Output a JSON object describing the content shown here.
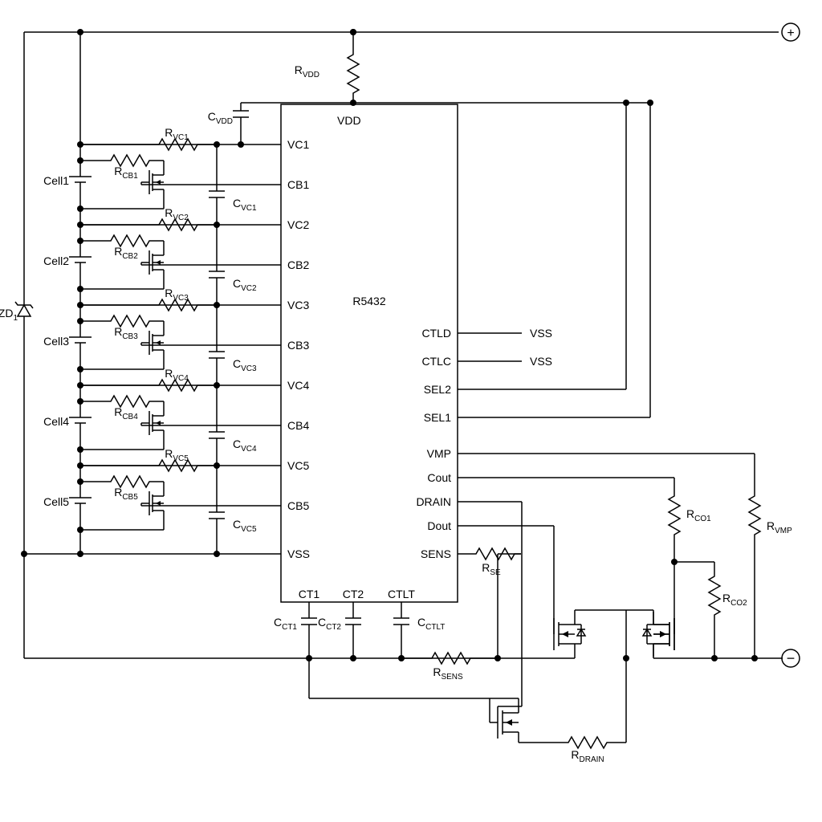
{
  "ic": {
    "name": "R5432"
  },
  "pins_left": [
    "VDD",
    "VC1",
    "CB1",
    "VC2",
    "CB2",
    "VC3",
    "CB3",
    "VC4",
    "CB4",
    "VC5",
    "CB5",
    "VSS"
  ],
  "pins_right": [
    "CTLD",
    "CTLC",
    "SEL2",
    "SEL1",
    "VMP",
    "Cout",
    "DRAIN",
    "Dout",
    "SENS"
  ],
  "pins_bottom": [
    "CT1",
    "CT2",
    "CTLT"
  ],
  "cells": [
    "Cell1",
    "Cell2",
    "Cell3",
    "Cell4",
    "Cell5"
  ],
  "resistors": {
    "rvdd": "R",
    "rvdd_sub": "VDD",
    "rvc": [
      "R",
      "VC1",
      "R",
      "VC2",
      "R",
      "VC3",
      "R",
      "VC4",
      "R",
      "VC5"
    ],
    "rcb": [
      "R",
      "CB1",
      "R",
      "CB2",
      "R",
      "CB3",
      "R",
      "CB4",
      "R",
      "CB5"
    ],
    "rse": "R",
    "rse_sub": "SE",
    "rsens": "R",
    "rsens_sub": "SENS",
    "rdrain": "R",
    "rdrain_sub": "DRAIN",
    "rco1": "R",
    "rco1_sub": "CO1",
    "rco2": "R",
    "rco2_sub": "CO2",
    "rvmp": "R",
    "rvmp_sub": "VMP"
  },
  "caps": {
    "cvdd": "C",
    "cvdd_sub": "VDD",
    "cvc": [
      "C",
      "VC1",
      "C",
      "VC2",
      "C",
      "VC3",
      "C",
      "VC4",
      "C",
      "VC5"
    ],
    "cct1": "C",
    "cct1_sub": "CT1",
    "cct2": "C",
    "cct2_sub": "CT2",
    "cctlt": "C",
    "cctlt_sub": "CTLT"
  },
  "zd": "ZD",
  "zd_sub": "1",
  "ctl_tie": [
    "VSS",
    "VSS"
  ],
  "terminals": {
    "plus": "+",
    "minus": "−"
  }
}
